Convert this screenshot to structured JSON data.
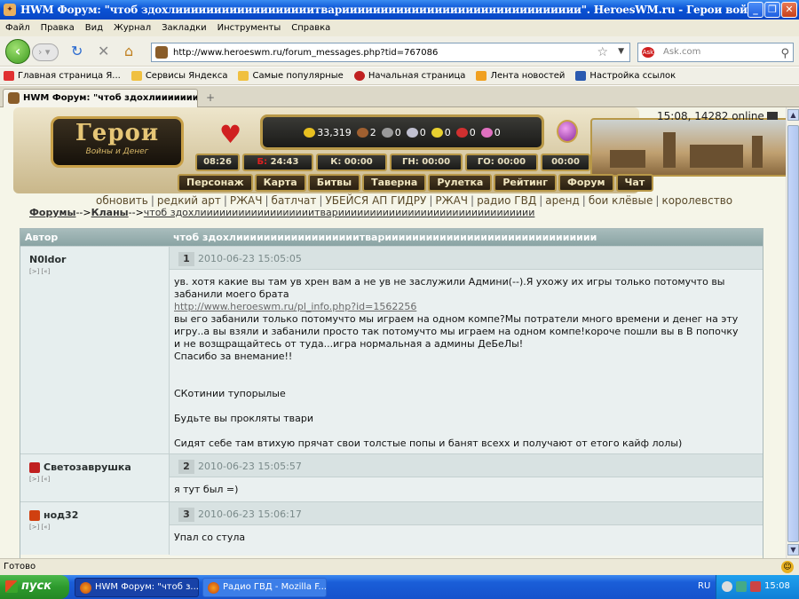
{
  "window": {
    "title": "HWM Форум: \"чтоб здохлиииииииииииииииииитвариииииииииииииииииииииииииииииии\". HeroesWM.ru - Герои войны и денег. Онлайн игра. - ...",
    "min": "_",
    "max": "❐",
    "close": "✕"
  },
  "menu": [
    "Файл",
    "Правка",
    "Вид",
    "Журнал",
    "Закладки",
    "Инструменты",
    "Справка"
  ],
  "nav": {
    "url": "http://www.heroeswm.ru/forum_messages.php?tid=767086",
    "search_placeholder": "Ask.com"
  },
  "bookmarks": [
    "Главная страница Я...",
    "Сервисы Яндекса",
    "Самые популярные",
    "Начальная страница",
    "Лента новостей",
    "Настройка ссылок"
  ],
  "tab": {
    "label": "HWM Форум: \"чтоб здохлиииииииии...",
    "new": "+"
  },
  "game": {
    "logo_title": "Герои",
    "logo_sub": "Войны и Денег",
    "clock": "15:08, 14282 online",
    "resources": [
      "33,319",
      "2",
      "0",
      "0",
      "0",
      "0",
      "0"
    ],
    "timers": [
      {
        "label": "08:26"
      },
      {
        "label": "24:43",
        "prefix": "Б:"
      },
      {
        "label": "К: 00:00"
      },
      {
        "label": "ГН: 00:00"
      },
      {
        "label": "ГО: 00:00"
      },
      {
        "label": "00:00"
      }
    ],
    "tabs": [
      "Персонаж",
      "Карта",
      "Битвы",
      "Таверна",
      "Рулетка",
      "Рейтинг",
      "Форум",
      "Чат"
    ],
    "links": [
      "обновить",
      "редкий арт",
      "РЖАЧ",
      "батлчат",
      "УБЕЙСЯ АП ГИДРУ",
      "РЖАЧ",
      "радио ГВД",
      "аренд",
      "бои клёвые",
      "королевство"
    ]
  },
  "breadcrumb": {
    "forums": "Форумы",
    "arrow": "-->",
    "clans": "Кланы",
    "topic": "чтоб здохлиииииииииииииииииитвариииииииииииииииииииииииииииииии"
  },
  "forum": {
    "col_author": "Автор",
    "col_topic": "чтоб здохлиииииииииииииииииитвариииииииииииииииииииииииииииииии",
    "posts": [
      {
        "author": "N0ldor",
        "actions": "[>] [«]",
        "num": "1",
        "date": "2010-06-23 15:05:05",
        "lines": [
          "ув. хотя какие вы там ув хрен вам а не ув не заслужили Админи(--).Я ухожу их игры только потомучто вы",
          "забанили моего брата",
          "http://www.heroeswm.ru/pl_info.php?id=1562256",
          "вы его забанили только потомучто мы играем на одном компе?Мы потратели много времени и денег на эту",
          "игру..а вы взяли и забанили просто так потомучто мы играем на одном компе!короче пошли вы в В попочку",
          "и не возщращайтесь от туда...игра нормальная а админы ДеБеЛы!",
          "Спасибо за внемание!!",
          "",
          "",
          "СКотинии тупорылые",
          "",
          "Будьте вы прокляты твари",
          "",
          "Сидят себе там втихую прячат свои толстые попы и банят всеxх и получают от етого кайф лолы)"
        ]
      },
      {
        "author": "Светозаврушка",
        "actions": "[>] [«]",
        "num": "2",
        "date": "2010-06-23 15:05:57",
        "lines": [
          "я тут был =)"
        ]
      },
      {
        "author": "нод32",
        "actions": "[>] [«]",
        "num": "3",
        "date": "2010-06-23 15:06:17",
        "lines": [
          "Упал со стула"
        ]
      }
    ]
  },
  "status": {
    "text": "Готово"
  },
  "taskbar": {
    "start": "пуск",
    "tasks": [
      "HWM Форум: \"чтоб з...",
      "Радио ГВД - Mozilla F..."
    ],
    "lang": "RU",
    "time": "15:08"
  },
  "colors": {
    "titlebar": "#0a53d6",
    "forum_header": "#8aa4a4",
    "row_bg": "#e6eeee",
    "gold": "#b89848"
  }
}
